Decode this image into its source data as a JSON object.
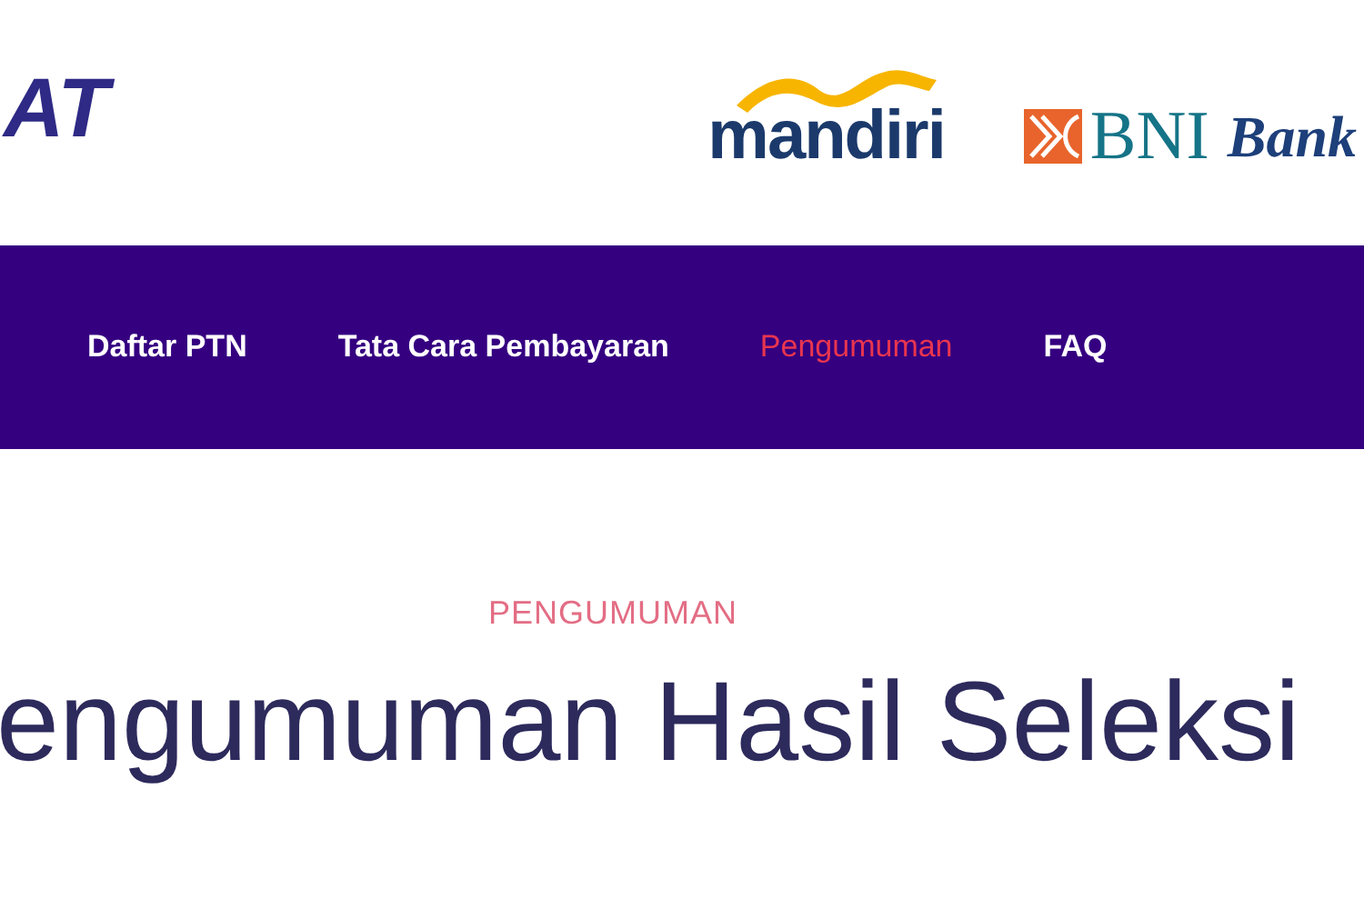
{
  "header": {
    "logo_text": "AT",
    "partners": [
      {
        "kind": "mandiri",
        "name": "mandiri"
      },
      {
        "kind": "bni",
        "name": "BNI",
        "tagline": "Bank"
      }
    ]
  },
  "nav": {
    "items": [
      {
        "label": "Daftar PTN",
        "selected": false
      },
      {
        "label": "Tata Cara Pembayaran",
        "selected": false
      },
      {
        "label": "Pengumuman",
        "selected": true
      },
      {
        "label": "FAQ",
        "selected": false
      }
    ]
  },
  "section": {
    "eyebrow": "PENGUMUMAN",
    "title": "engumuman Hasil Seleksi"
  }
}
